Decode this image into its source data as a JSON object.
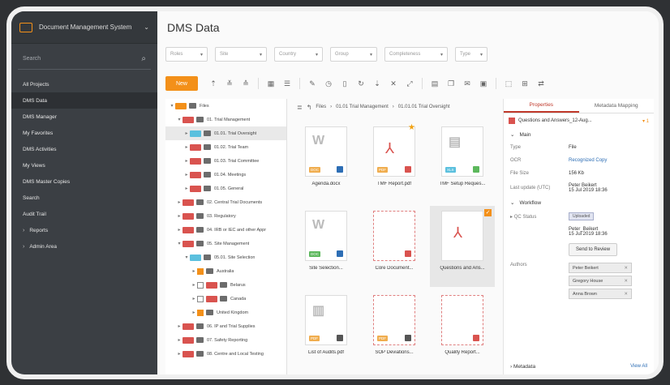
{
  "sidebar": {
    "app_title": "Document Management System",
    "search_placeholder": "Search",
    "items": [
      {
        "label": "All Projects",
        "active": false,
        "expandable": false
      },
      {
        "label": "DMS Data",
        "active": true,
        "expandable": false
      },
      {
        "label": "DMS Manager",
        "active": false,
        "expandable": false
      },
      {
        "label": "My Favorites",
        "active": false,
        "expandable": false
      },
      {
        "label": "DMS Activities",
        "active": false,
        "expandable": false
      },
      {
        "label": "My Views",
        "active": false,
        "expandable": false
      },
      {
        "label": "DMS Master Copies",
        "active": false,
        "expandable": false
      },
      {
        "label": "Search",
        "active": false,
        "expandable": false
      },
      {
        "label": "Audit Trail",
        "active": false,
        "expandable": false
      },
      {
        "label": "Reports",
        "active": false,
        "expandable": true
      },
      {
        "label": "Admin Area",
        "active": false,
        "expandable": true
      }
    ]
  },
  "main": {
    "title": "DMS Data",
    "filters": [
      "Roles",
      "Site",
      "Country",
      "Group",
      "Completeness",
      "Type"
    ],
    "new_label": "New"
  },
  "tree": {
    "rows": [
      {
        "label": "Files",
        "indent": 0,
        "toggle": "▾",
        "tag": "#f39019",
        "check": null
      },
      {
        "label": "01. Trial Management",
        "indent": 1,
        "toggle": "▾",
        "tag": "#d9534f",
        "check": null
      },
      {
        "label": "01.01. Trial Oversight",
        "indent": 2,
        "toggle": "▸",
        "tag": "#5bc0de",
        "check": null,
        "selected": true
      },
      {
        "label": "01.02. Trial Team",
        "indent": 2,
        "toggle": "▸",
        "tag": "#d9534f",
        "check": null
      },
      {
        "label": "01.03. Trial Committee",
        "indent": 2,
        "toggle": "▸",
        "tag": "#d9534f",
        "check": null
      },
      {
        "label": "01.04. Meetings",
        "indent": 2,
        "toggle": "▸",
        "tag": "#d9534f",
        "check": null
      },
      {
        "label": "01.05. General",
        "indent": 2,
        "toggle": "▸",
        "tag": "#d9534f",
        "check": null
      },
      {
        "label": "02. Central Trial Documents",
        "indent": 1,
        "toggle": "▸",
        "tag": "#d9534f",
        "check": null
      },
      {
        "label": "03. Regulatory",
        "indent": 1,
        "toggle": "▸",
        "tag": "#d9534f",
        "check": null
      },
      {
        "label": "04. IRB or IEC and other Appr",
        "indent": 1,
        "toggle": "▸",
        "tag": "#d9534f",
        "check": null
      },
      {
        "label": "05. Site Management",
        "indent": 1,
        "toggle": "▾",
        "tag": "#d9534f",
        "check": null
      },
      {
        "label": "05.01. Site Selection",
        "indent": 2,
        "toggle": "▾",
        "tag": "#5bc0de",
        "check": null
      },
      {
        "label": "Australia",
        "indent": 3,
        "toggle": "▸",
        "tag": null,
        "check": "checked"
      },
      {
        "label": "Belarus",
        "indent": 3,
        "toggle": "▸",
        "tag": "#d9534f",
        "check": "empty"
      },
      {
        "label": "Canada",
        "indent": 3,
        "toggle": "▸",
        "tag": "#d9534f",
        "check": "empty"
      },
      {
        "label": "United Kingdom",
        "indent": 3,
        "toggle": "▸",
        "tag": null,
        "check": "checked"
      },
      {
        "label": "06. IP and Trial Supplies",
        "indent": 1,
        "toggle": "▸",
        "tag": "#d9534f",
        "check": null
      },
      {
        "label": "07. Safety Reporting",
        "indent": 1,
        "toggle": "▸",
        "tag": "#d9534f",
        "check": null
      },
      {
        "label": "08. Centre and Local Testing",
        "indent": 1,
        "toggle": "▸",
        "tag": "#d9534f",
        "check": null
      }
    ]
  },
  "files": {
    "breadcrumb": [
      "Files",
      "01.01 Trial Management",
      "01.01.01 Trial Oversight"
    ],
    "tiles": [
      {
        "name": "Agenda.docx",
        "kind": "doc",
        "tag": "DOC",
        "tag_color": "#f0ad4e",
        "gico": "#2d6eb5"
      },
      {
        "name": "TMF Report.pdf",
        "kind": "pdf",
        "tag": "PDF",
        "tag_color": "#f0ad4e",
        "gico": "#d9534f",
        "star": true
      },
      {
        "name": "TMF Setup Reques...",
        "kind": "xls",
        "tag": "XLS",
        "tag_color": "#5bc0de",
        "gico": "#5cb85c"
      },
      {
        "name": "Site Selection...",
        "kind": "doc",
        "tag": "DOC",
        "tag_color": "#5cb85c",
        "gico": "#2d6eb5"
      },
      {
        "name": "Core Document...",
        "kind": "empty",
        "tag": "",
        "tag_color": "",
        "gico": "#d9534f"
      },
      {
        "name": "Questions and Ans...",
        "kind": "pdf",
        "tag": "",
        "tag_color": "",
        "gico": "",
        "selected": true,
        "checked": true
      },
      {
        "name": "List of Audits.pdf",
        "kind": "zip",
        "tag": "PDF",
        "tag_color": "#f0ad4e",
        "gico": "#555"
      },
      {
        "name": "SOP Deviations...",
        "kind": "empty",
        "tag": "PDF",
        "tag_color": "#f0ad4e",
        "gico": "#555"
      },
      {
        "name": "Quality Report...",
        "kind": "empty",
        "tag": "",
        "tag_color": "",
        "gico": "#d9534f"
      }
    ]
  },
  "props": {
    "tabs": [
      {
        "label": "Properties",
        "active": true
      },
      {
        "label": "Metadata Mapping",
        "active": false
      }
    ],
    "file_name": "Questions and Answers_12-Aug...",
    "file_more": "▾ 1",
    "main_section": "Main",
    "rows": [
      {
        "key": "Type",
        "value": "File",
        "link": false
      },
      {
        "key": "OCR",
        "value": "Recognized Copy",
        "link": true
      },
      {
        "key": "File Size",
        "value": "156 Kb",
        "link": false
      },
      {
        "key": "Last update (UTC)",
        "value": "Peter Beikert",
        "value2": "15 Jul 2019 18:36",
        "link": false
      }
    ],
    "workflow_section": "Workflow",
    "qc_key": "QC Status",
    "qc_status": "Uploaded",
    "qc_user": "Peter_Beikert",
    "qc_date": "15 Jul 2019  18:36",
    "send_review": "Send to Review",
    "authors_key": "Authors",
    "authors": [
      "Peter Beikert",
      "Gregory House",
      "Anna Brown"
    ],
    "metadata_label": "Metadata",
    "view_all": "View All"
  }
}
